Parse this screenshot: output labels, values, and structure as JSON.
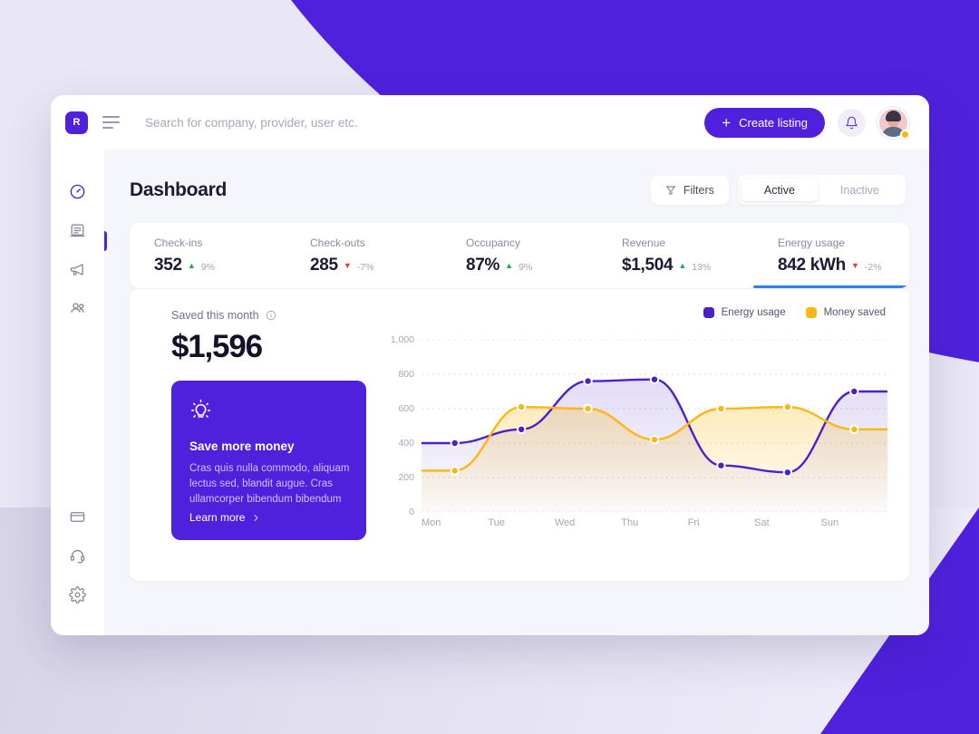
{
  "topbar": {
    "logo_text": "R",
    "menu_icon": "hamburger-icon",
    "search_placeholder": "Search for company, provider, user etc.",
    "search_value": "",
    "create_label": "Create listing",
    "bell_icon": "bell-icon"
  },
  "sidebar": {
    "items": [
      {
        "name": "dashboard",
        "icon": "gauge-icon",
        "active": true
      },
      {
        "name": "reports",
        "icon": "document-icon",
        "active": false
      },
      {
        "name": "announcements",
        "icon": "megaphone-icon",
        "active": false
      },
      {
        "name": "users",
        "icon": "users-icon",
        "active": false
      }
    ],
    "bottom_items": [
      {
        "name": "billing",
        "icon": "card-icon"
      },
      {
        "name": "support",
        "icon": "headset-icon"
      },
      {
        "name": "settings",
        "icon": "gear-icon"
      }
    ]
  },
  "page": {
    "title": "Dashboard",
    "filters_label": "Filters",
    "filters_icon": "funnel-icon",
    "segments": [
      {
        "label": "Active",
        "active": true
      },
      {
        "label": "Inactive",
        "active": false
      }
    ]
  },
  "stats": [
    {
      "label": "Check-ins",
      "value": "352",
      "trend": "up",
      "delta": "9%",
      "marker": "▲",
      "selected": false
    },
    {
      "label": "Check-outs",
      "value": "285",
      "trend": "down",
      "delta": "-7%",
      "marker": "▼",
      "selected": false
    },
    {
      "label": "Occupancy",
      "value": "87%",
      "trend": "up",
      "delta": "9%",
      "marker": "▲",
      "selected": false
    },
    {
      "label": "Revenue",
      "value": "$1,504",
      "trend": "up",
      "delta": "13%",
      "marker": "▲",
      "selected": false
    },
    {
      "label": "Energy usage",
      "value": "842 kWh",
      "trend": "down",
      "delta": "-2%",
      "marker": "▼",
      "selected": true
    }
  ],
  "saved_panel": {
    "label": "Saved this month",
    "info_icon": "info-icon",
    "amount": "$1,596"
  },
  "promo": {
    "icon": "lightbulb-icon",
    "title": "Save more money",
    "body": "Cras quis nulla commodo, aliquam lectus sed, blandit augue. Cras ullamcorper bibendum bibendum",
    "link_label": "Learn more",
    "link_icon": "chevron-right-icon"
  },
  "colors": {
    "brand_purple": "#4f21dd",
    "series_energy": "#4b21c9",
    "series_money": "#fbb713",
    "underline_blue": "#2f80ed",
    "up_green": "#20a35a",
    "down_red": "#ea3b35",
    "page_bg": "#e9e7f6",
    "card_bg": "#ffffff"
  },
  "chart_data": {
    "type": "line",
    "title": "",
    "xlabel": "",
    "ylabel": "",
    "grid": true,
    "legend_position": "top-right",
    "ylim": [
      0,
      1000
    ],
    "yticks": [
      0,
      200,
      400,
      600,
      800,
      1000
    ],
    "ytick_labels": [
      "0",
      "200",
      "400",
      "600",
      "800",
      "1,000"
    ],
    "categories": [
      "Mon",
      "Tue",
      "Wed",
      "Thu",
      "Fri",
      "Sat",
      "Sun"
    ],
    "series": [
      {
        "name": "Energy usage",
        "color": "#4b21c9",
        "values": [
          400,
          480,
          760,
          770,
          270,
          230,
          700
        ]
      },
      {
        "name": "Money saved",
        "color": "#fbb713",
        "values": [
          240,
          610,
          600,
          420,
          600,
          610,
          480
        ]
      }
    ]
  }
}
